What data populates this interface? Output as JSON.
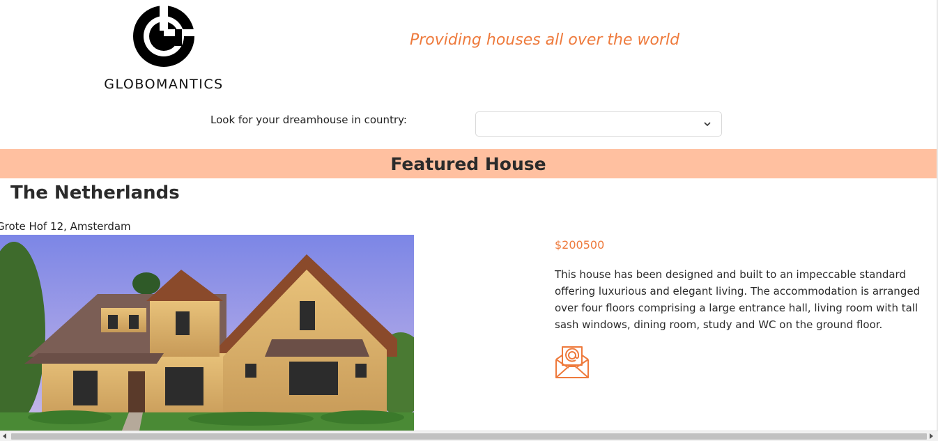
{
  "header": {
    "logo_text": "GLOBOMANTICS",
    "tagline": "Providing houses all over the world"
  },
  "search": {
    "label": "Look for your dreamhouse in country:",
    "selected_value": ""
  },
  "featured": {
    "title": "Featured House",
    "country": "The Netherlands",
    "address": "Grote Hof 12, Amsterdam",
    "price": "$200500",
    "description": "This house has been designed and built to an impeccable standard offering luxurious and elegant living. The accommodation is arranged over four floors comprising a large entrance hall, living room with tall sash windows, dining room, study and WC on the ground floor."
  },
  "icons": {
    "logo": "globomantics-logo-icon",
    "select_chevron": "chevron-down-icon",
    "contact": "email-envelope-icon"
  },
  "colors": {
    "accent": "#ee7a3c",
    "banner": "#ffc0a0"
  }
}
